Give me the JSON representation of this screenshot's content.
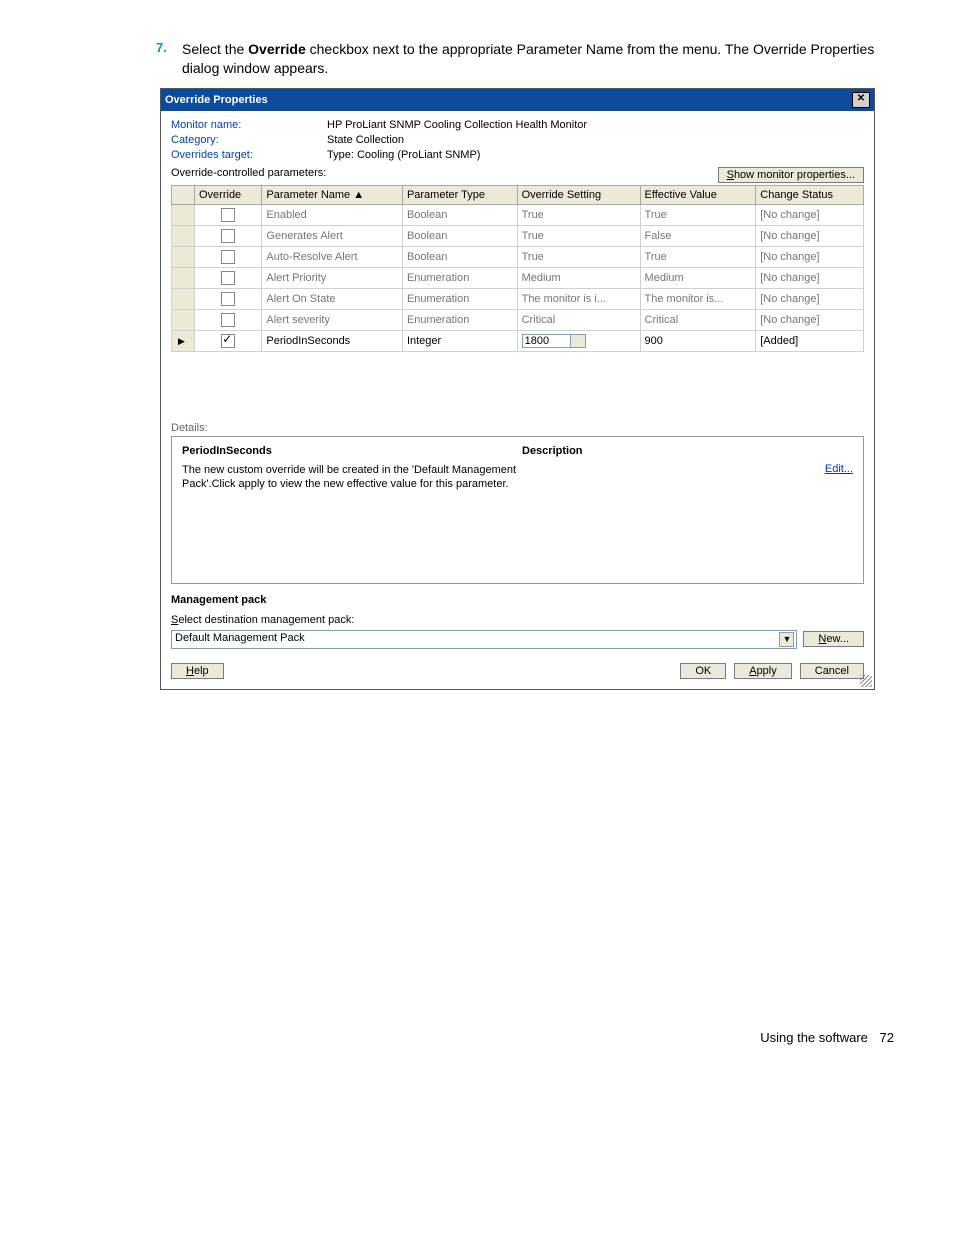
{
  "step": {
    "num": "7.",
    "text_before": "Select the ",
    "bold": "Override",
    "text_after": " checkbox next to the appropriate Parameter Name from the menu. The Override Properties dialog window appears."
  },
  "dialog": {
    "title": "Override Properties",
    "monitor_name_label": "Monitor name:",
    "monitor_name_value": "HP ProLiant SNMP Cooling Collection Health Monitor",
    "category_label": "Category:",
    "category_value": "State Collection",
    "target_label": "Overrides target:",
    "target_value": "Type: Cooling (ProLiant SNMP)",
    "section_label": "Override-controlled parameters:",
    "show_props_btn": "Show monitor properties...",
    "columns": [
      "",
      "Override",
      "Parameter Name   ▲",
      "Parameter Type",
      "Override Setting",
      "Effective Value",
      "Change Status"
    ],
    "rows": [
      {
        "checked": false,
        "name": "Enabled",
        "type": "Boolean",
        "setting": "True",
        "effective": "True",
        "status": "[No change]"
      },
      {
        "checked": false,
        "name": "Generates Alert",
        "type": "Boolean",
        "setting": "True",
        "effective": "False",
        "status": "[No change]"
      },
      {
        "checked": false,
        "name": "Auto-Resolve Alert",
        "type": "Boolean",
        "setting": "True",
        "effective": "True",
        "status": "[No change]"
      },
      {
        "checked": false,
        "name": "Alert Priority",
        "type": "Enumeration",
        "setting": "Medium",
        "effective": "Medium",
        "status": "[No change]"
      },
      {
        "checked": false,
        "name": "Alert On State",
        "type": "Enumeration",
        "setting": "The monitor is i...",
        "effective": "The monitor is...",
        "status": "[No change]"
      },
      {
        "checked": false,
        "name": "Alert severity",
        "type": "Enumeration",
        "setting": "Critical",
        "effective": "Critical",
        "status": "[No change]"
      },
      {
        "checked": true,
        "name": "PeriodInSeconds",
        "type": "Integer",
        "setting": "1800",
        "effective": "900",
        "status": "[Added]",
        "active": true,
        "spinner": true
      }
    ],
    "details_label": "Details:",
    "details_title": "PeriodInSeconds",
    "details_desc_hdr": "Description",
    "details_msg": "The new custom override will be created in the 'Default Management Pack'.Click apply to view  the new effective value for this parameter.",
    "edit_link": "Edit...",
    "mgmt_title": "Management pack",
    "mgmt_select_label": "Select destination management pack:",
    "mgmt_value": "Default Management Pack",
    "new_btn": "New...",
    "help_btn": "Help",
    "ok_btn": "OK",
    "apply_btn": "Apply",
    "cancel_btn": "Cancel"
  },
  "footer": {
    "text": "Using the software",
    "page": "72"
  }
}
